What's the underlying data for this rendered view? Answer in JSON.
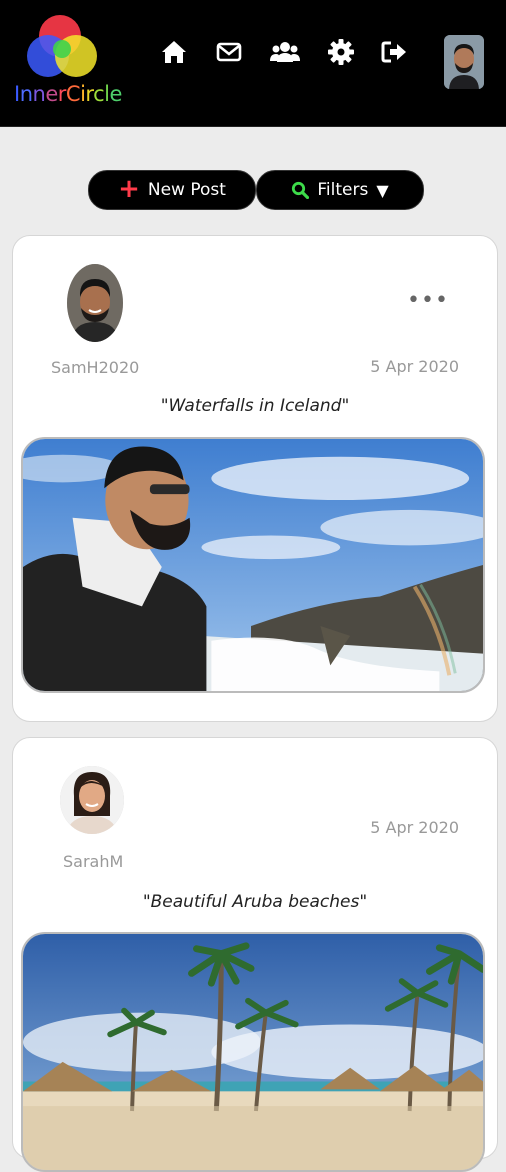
{
  "app": {
    "name": "InnerCircle",
    "logo_letters": [
      {
        "ch": "I",
        "color": "#3b5bff"
      },
      {
        "ch": "n",
        "color": "#4f6bff"
      },
      {
        "ch": "n",
        "color": "#7c57e0"
      },
      {
        "ch": "e",
        "color": "#c24b8c"
      },
      {
        "ch": "r",
        "color": "#ff4b5a"
      },
      {
        "ch": "C",
        "color": "#ff6a3b"
      },
      {
        "ch": "i",
        "color": "#ffb52a"
      },
      {
        "ch": "r",
        "color": "#e7d52a"
      },
      {
        "ch": "c",
        "color": "#9ede3b"
      },
      {
        "ch": "l",
        "color": "#6fd14b"
      },
      {
        "ch": "e",
        "color": "#4fcf6b"
      }
    ]
  },
  "nav": {
    "icons": [
      "home-icon",
      "mail-icon",
      "friends-icon",
      "settings-icon",
      "logout-icon"
    ]
  },
  "toolbar": {
    "new_post_label": "New Post",
    "filters_label": "Filters",
    "plus_symbol": "+",
    "filter_arrow": "▼"
  },
  "posts": [
    {
      "username": "SamH2020",
      "date": "5 Apr 2020",
      "caption": "\"Waterfalls in Iceland\"",
      "menu": "•••"
    },
    {
      "username": "SarahM",
      "date": "5 Apr 2020",
      "caption": "\"Beautiful Aruba beaches\""
    }
  ],
  "colors": {
    "header_bg": "#000000",
    "page_bg": "#ececec",
    "plus_red": "#ff3b4a",
    "search_green": "#3ddc4a"
  }
}
